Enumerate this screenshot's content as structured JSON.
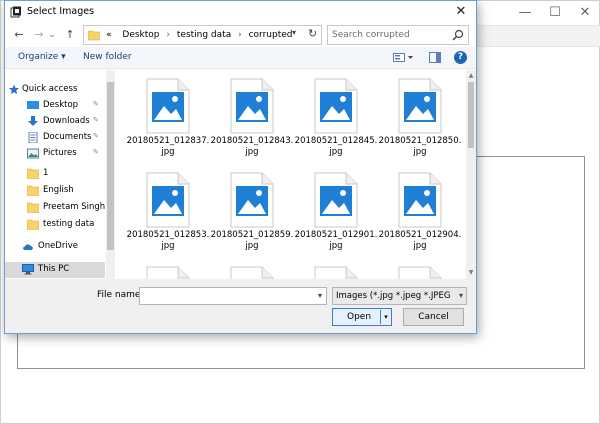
{
  "background_window": {
    "minimize_glyph": "—",
    "maximize_glyph": "☐",
    "close_glyph": "✕"
  },
  "dialog": {
    "title": "Select Images",
    "close_glyph": "✕"
  },
  "navigation": {
    "back_glyph": "←",
    "forward_glyph": "→",
    "recent_glyph": "⌄",
    "up_glyph": "↑",
    "breadcrumb_prefix": "«",
    "breadcrumb": [
      "Desktop",
      "testing data",
      "corrupted"
    ],
    "refresh_glyph": "↻",
    "search_placeholder": "Search corrupted"
  },
  "command_bar": {
    "organize_label": "Organize ▾",
    "new_folder_label": "New folder",
    "help_label": "?"
  },
  "nav_pane": {
    "items": [
      {
        "label": "Quick access",
        "icon": "star-icon"
      },
      {
        "label": "Desktop",
        "icon": "desktop-icon",
        "pinned": true
      },
      {
        "label": "Downloads",
        "icon": "download-icon",
        "pinned": true
      },
      {
        "label": "Documents",
        "icon": "documents-icon",
        "pinned": true
      },
      {
        "label": "Pictures",
        "icon": "pictures-icon",
        "pinned": true
      },
      {
        "label": "1",
        "icon": "folder-icon"
      },
      {
        "label": "English",
        "icon": "folder-icon"
      },
      {
        "label": "Preetam Singh",
        "icon": "folder-icon"
      },
      {
        "label": "testing data",
        "icon": "folder-icon"
      },
      {
        "label": "OneDrive",
        "icon": "cloud-icon"
      },
      {
        "label": "This PC",
        "icon": "computer-icon",
        "selected": true
      }
    ],
    "pin_glyph": "📌"
  },
  "files": [
    {
      "line1": "20180521_012837.",
      "line2": "jpg"
    },
    {
      "line1": "20180521_012843.",
      "line2": "jpg"
    },
    {
      "line1": "20180521_012845.",
      "line2": "jpg"
    },
    {
      "line1": "20180521_012850.",
      "line2": "jpg"
    },
    {
      "line1": "20180521_012853.",
      "line2": "jpg"
    },
    {
      "line1": "20180521_012859.",
      "line2": "jpg"
    },
    {
      "line1": "20180521_012901.",
      "line2": "jpg"
    },
    {
      "line1": "20180521_012904.",
      "line2": "jpg"
    },
    {
      "line1": "",
      "line2": ""
    },
    {
      "line1": "",
      "line2": ""
    },
    {
      "line1": "",
      "line2": ""
    },
    {
      "line1": "",
      "line2": ""
    }
  ],
  "bottom": {
    "file_name_label": "File name:",
    "file_name_value": "",
    "filter_value": "Images (*.jpg *.jpeg *.JPEG *.JPG",
    "open_label": "Open",
    "cancel_label": "Cancel",
    "dropdown_glyph": "▾"
  },
  "colors": {
    "accent": "#1c66b8",
    "image_icon_blue": "#1e7fd4",
    "folder_yellow": "#f6d36b"
  }
}
